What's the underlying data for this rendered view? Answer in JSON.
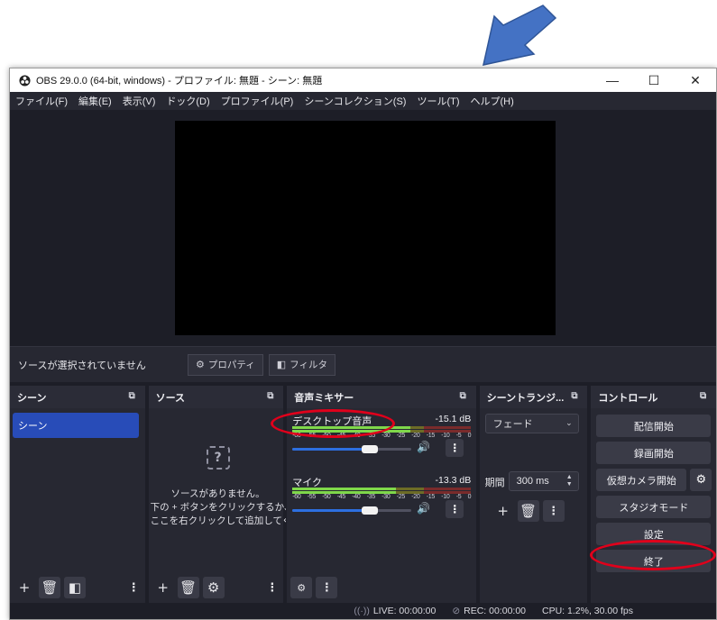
{
  "window": {
    "title": "OBS 29.0.0 (64-bit, windows) - プロファイル: 無題 - シーン: 無題",
    "minimize": "—",
    "maximize": "☐",
    "close": "✕"
  },
  "menu": [
    "ファイル(F)",
    "編集(E)",
    "表示(V)",
    "ドック(D)",
    "プロファイル(P)",
    "シーンコレクション(S)",
    "ツール(T)",
    "ヘルプ(H)"
  ],
  "source_toolbar": {
    "no_source": "ソースが選択されていません",
    "properties": "プロパティ",
    "filters": "フィルタ"
  },
  "docks": {
    "scenes": {
      "title": "シーン",
      "items": [
        "シーン"
      ]
    },
    "sources": {
      "title": "ソース",
      "empty_icon": "?",
      "empty_lines": [
        "ソースがありません。",
        "下の + ボタンをクリックするか、",
        "ここを右クリックして追加してく"
      ]
    },
    "mixer": {
      "title": "音声ミキサー",
      "ticks": [
        "-60",
        "-55",
        "-50",
        "-45",
        "-40",
        "-35",
        "-30",
        "-25",
        "-20",
        "-15",
        "-10",
        "-5",
        "0"
      ],
      "channels": [
        {
          "name": "デスクトップ音声",
          "db": "-15.1 dB",
          "level": 0.66,
          "volume": 0.65
        },
        {
          "name": "マイク",
          "db": "-13.3 dB",
          "level": 0.58,
          "volume": 0.65
        }
      ]
    },
    "transitions": {
      "title": "シーントランジ...",
      "type": "フェード",
      "duration_label": "期間",
      "duration": "300 ms"
    },
    "controls": {
      "title": "コントロール",
      "start_streaming": "配信開始",
      "start_recording": "録画開始",
      "virtual_camera": "仮想カメラ開始",
      "studio_mode": "スタジオモード",
      "settings": "設定",
      "exit": "終了"
    }
  },
  "status": {
    "live": "LIVE: 00:00:00",
    "rec": "REC: 00:00:00",
    "cpu": "CPU: 1.2%, 30.00 fps"
  },
  "colors": {
    "accent": "#284cb8",
    "highlight": "#e0001b",
    "arrow": "#4472c4"
  }
}
